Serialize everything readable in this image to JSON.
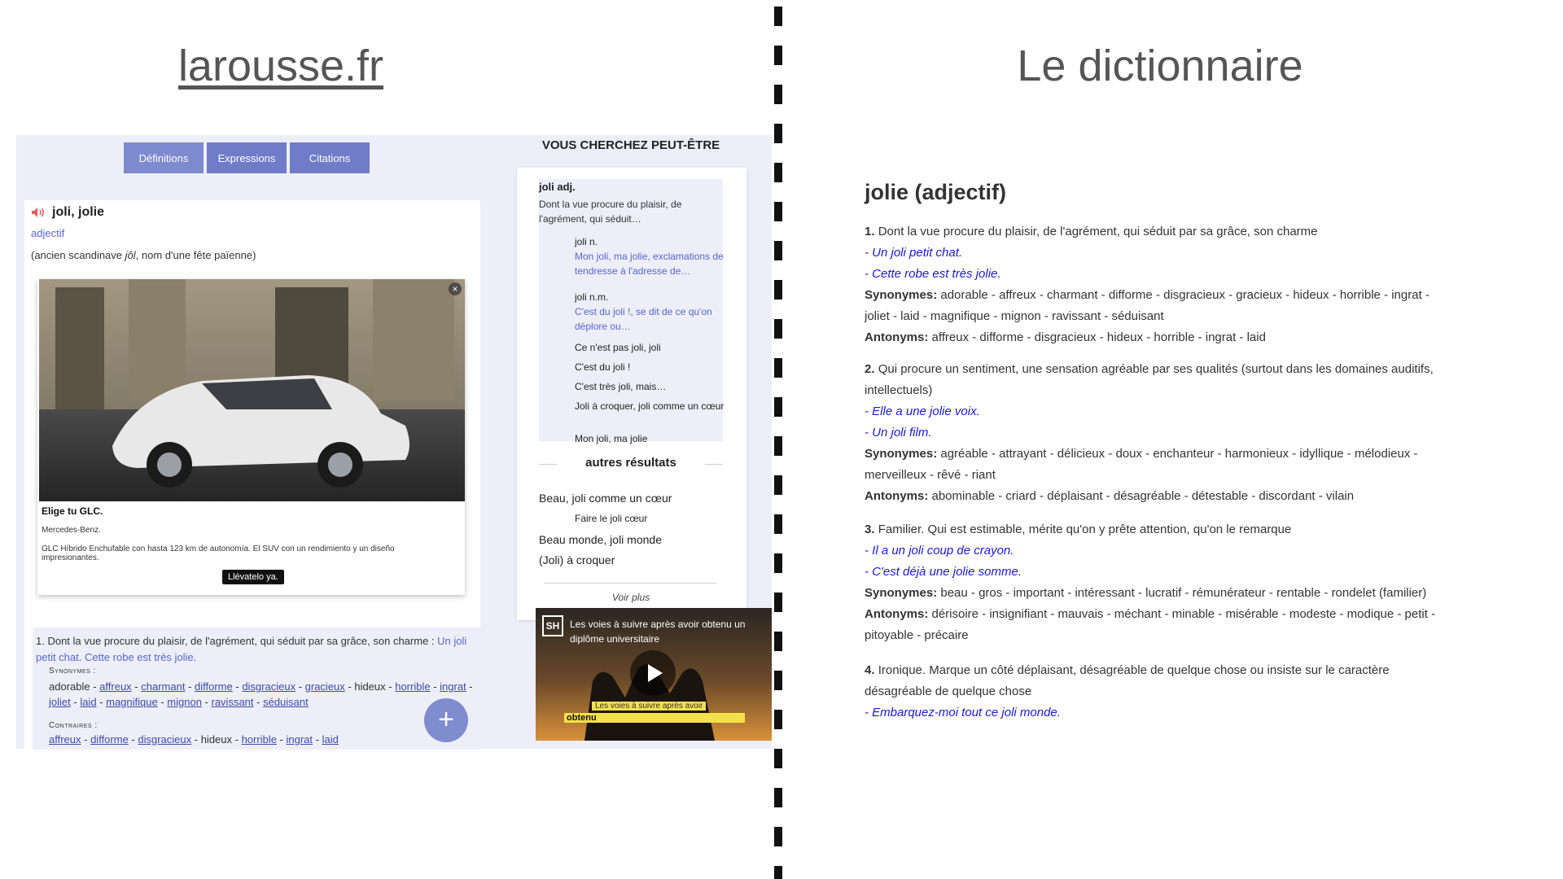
{
  "headings": {
    "left": "larousse.fr",
    "right": "Le dictionnaire"
  },
  "larousse": {
    "tabs": [
      "Définitions",
      "Expressions",
      "Citations"
    ],
    "entry": {
      "word": "joli, jolie",
      "pos": "adjectif",
      "etym_prefix": "(ancien scandinave ",
      "etym_word": "jôl",
      "etym_suffix": ", nom d'une fête païenne)"
    },
    "ad": {
      "title": "Elige tu GLC.",
      "brand": "Mercedes-Benz.",
      "description": "GLC Híbrido Enchufable con hasta 123 km de autonomía. El SUV con un rendimiento y un diseño impresionantes.",
      "cta": "Llévatelo ya.",
      "close": "×"
    },
    "definition": {
      "text": "1. Dont la vue procure du plaisir, de l'agrément, qui séduit par sa grâce, son charme : ",
      "examples": "Un joli petit chat. Cette robe est très jolie.",
      "synonyms_label": "Synonymes :",
      "synonyms": [
        {
          "w": "adorable",
          "link": false
        },
        {
          "w": "affreux",
          "link": true
        },
        {
          "w": "charmant",
          "link": true
        },
        {
          "w": "difforme",
          "link": true
        },
        {
          "w": "disgracieux",
          "link": true
        },
        {
          "w": "gracieux",
          "link": true
        },
        {
          "w": "hideux",
          "link": false
        },
        {
          "w": "horrible",
          "link": true
        },
        {
          "w": "ingrat",
          "link": true
        },
        {
          "w": "joliet",
          "link": true
        },
        {
          "w": "laid",
          "link": true
        },
        {
          "w": "magnifique",
          "link": true
        },
        {
          "w": "mignon",
          "link": true
        },
        {
          "w": "ravissant",
          "link": true
        },
        {
          "w": "séduisant",
          "link": true
        }
      ],
      "contraires_label": "Contraires :",
      "contraires": [
        {
          "w": "affreux",
          "link": true
        },
        {
          "w": "difforme",
          "link": true
        },
        {
          "w": "disgracieux",
          "link": true
        },
        {
          "w": "hideux",
          "link": false
        },
        {
          "w": "horrible",
          "link": true
        },
        {
          "w": "ingrat",
          "link": true
        },
        {
          "w": "laid",
          "link": true
        }
      ]
    },
    "sidebar": {
      "title": "VOUS CHERCHEZ PEUT-ÊTRE",
      "main": {
        "title": "joli adj.",
        "desc": "Dont la vue procure du plaisir, de l'agrément, qui séduit…"
      },
      "items": [
        {
          "title": "joli n.",
          "desc": "Mon joli, ma jolie, exclamations de tendresse à l'adresse de…"
        },
        {
          "title": "joli n.m.",
          "desc": "C'est du joli !, se dit de ce qu'on déplore ou…"
        },
        {
          "title": "Ce n'est pas joli, joli",
          "desc": ""
        },
        {
          "title": "C'est du joli !",
          "desc": ""
        },
        {
          "title": "C'est très joli, mais…",
          "desc": ""
        },
        {
          "title": "Joli à croquer, joli comme un cœur",
          "desc": ""
        },
        {
          "title": "Mon joli, ma jolie",
          "desc": ""
        }
      ],
      "autres_title": "autres résultats",
      "results": [
        "Beau, joli comme un cœur",
        "Faire le joli cœur",
        "Beau monde, joli monde",
        "(Joli) à croquer"
      ],
      "voir_plus": "Voir plus"
    },
    "video": {
      "logo": "SH",
      "title": "Les voies à suivre après avoir obtenu un diplôme universitaire",
      "caption1": "Les voies à suivre après avoir",
      "caption2": "obtenu"
    }
  },
  "dictionnaire": {
    "title": "jolie (adjectif)",
    "synonyms_label": "Synonymes:",
    "antonyms_label": "Antonyms:",
    "senses": [
      {
        "num": "1.",
        "text": "Dont la vue procure du plaisir, de l'agrément, qui séduit par sa grâce, son charme",
        "examples": [
          "- Un joli petit chat.",
          "- Cette robe est très jolie."
        ],
        "synonyms": "adorable - affreux - charmant - difforme - disgracieux - gracieux - hideux - horrible - ingrat - joliet - laid - magnifique - mignon - ravissant - séduisant",
        "antonyms": "affreux - difforme - disgracieux - hideux - horrible - ingrat - laid"
      },
      {
        "num": "2.",
        "text": "Qui procure un sentiment, une sensation agréable par ses qualités (surtout dans les domaines auditifs, intellectuels)",
        "examples": [
          "- Elle a une jolie voix.",
          "- Un joli film."
        ],
        "synonyms": "agréable - attrayant - délicieux - doux - enchanteur - harmonieux - idyllique - mélodieux - merveilleux - rêvé - riant",
        "antonyms": "abominable - criard - déplaisant - désagréable - détestable - discordant - vilain"
      },
      {
        "num": "3.",
        "text": "Familier. Qui est estimable, mérite qu'on y prête attention, qu'on le remarque",
        "examples": [
          "- Il a un joli coup de crayon.",
          "- C'est déjà une jolie somme."
        ],
        "synonyms": "beau - gros - important - intéressant - lucratif - rémunérateur - rentable - rondelet (familier)",
        "antonyms": "dérisoire - insignifiant - mauvais - méchant - minable - misérable - modeste - modique - petit - pitoyable - précaire"
      },
      {
        "num": "4.",
        "text": "Ironique. Marque un côté déplaisant, désagréable de quelque chose ou insiste sur le caractère désagréable de quelque chose",
        "examples": [
          "- Embarquez-moi tout ce joli monde."
        ],
        "synonyms": "",
        "antonyms": ""
      }
    ]
  }
}
